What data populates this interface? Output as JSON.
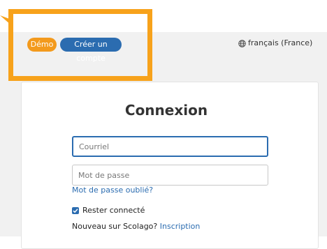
{
  "header": {
    "demo_badge": "Démo",
    "signup_badge": "Créer un compte",
    "language_icon": "globe-icon",
    "language": "français (France)"
  },
  "login": {
    "title": "Connexion",
    "email_placeholder": "Courriel",
    "email_value": "",
    "password_placeholder": "Mot de passe",
    "password_value": "",
    "forgot_password": "Mot de passe oublié?",
    "remember_me": "Rester connecté",
    "remember_checked": true,
    "new_user_text": "Nouveau sur Scolago?",
    "signup_link": "Inscription"
  },
  "colors": {
    "highlight": "#f7a21b",
    "demo_badge": "#f39a1d",
    "primary": "#2b6cb0",
    "background": "#f1f1f1"
  }
}
